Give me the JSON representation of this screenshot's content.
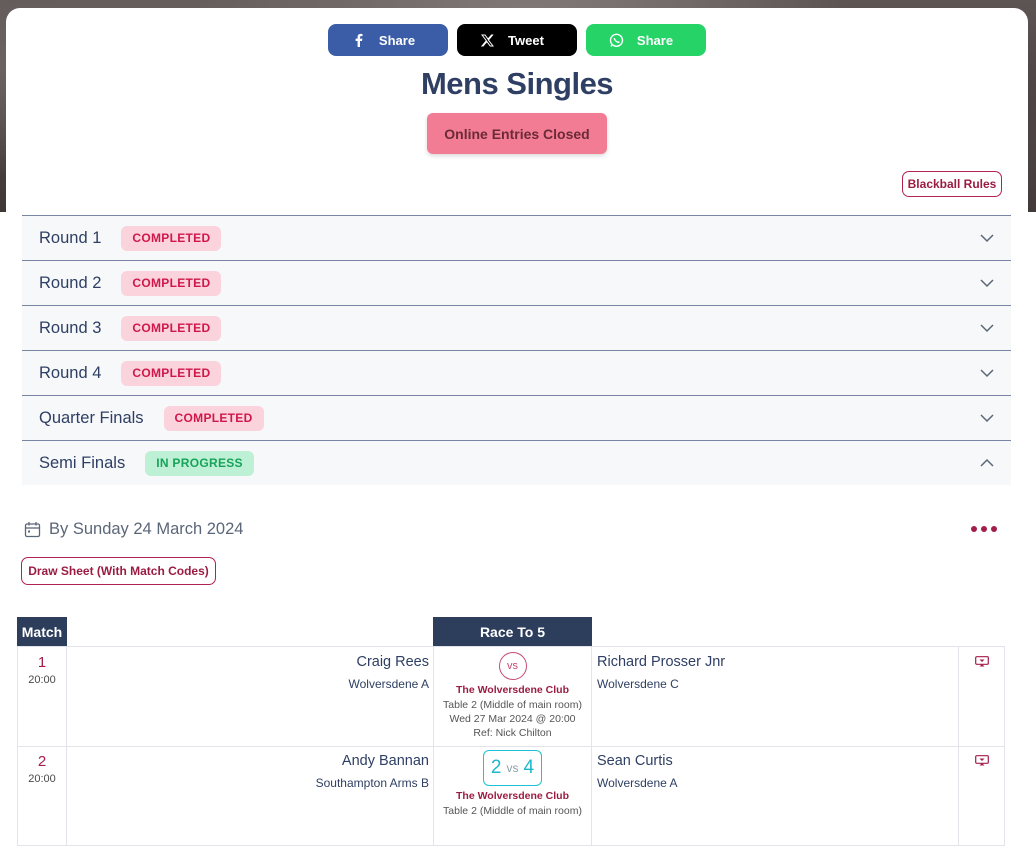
{
  "share": {
    "facebook_label": "Share",
    "twitter_label": "Tweet",
    "whatsapp_label": "Share"
  },
  "title": "Mens Singles",
  "entries_status": "Online Entries Closed",
  "rules_button": "Blackball Rules",
  "rounds": [
    {
      "name": "Round 1",
      "status": "COMPLETED",
      "expanded": false
    },
    {
      "name": "Round 2",
      "status": "COMPLETED",
      "expanded": false
    },
    {
      "name": "Round 3",
      "status": "COMPLETED",
      "expanded": false
    },
    {
      "name": "Round 4",
      "status": "COMPLETED",
      "expanded": false
    },
    {
      "name": "Quarter Finals",
      "status": "COMPLETED",
      "expanded": false
    },
    {
      "name": "Semi Finals",
      "status": "IN PROGRESS",
      "expanded": true
    }
  ],
  "semi": {
    "deadline": "By Sunday 24 March 2024",
    "draw_sheet_button": "Draw Sheet (With Match Codes)",
    "headers": {
      "match": "Match",
      "race": "Race To 5"
    },
    "matches": [
      {
        "num": "1",
        "time": "20:00",
        "home_player": "Craig Rees",
        "home_team": "Wolversdene A",
        "away_player": "Richard Prosser Jnr",
        "away_team": "Wolversdene C",
        "vs": "vs",
        "venue": "The Wolversdene Club",
        "table": "Table 2 (Middle of main room)",
        "when": "Wed 27 Mar 2024 @ 20:00",
        "ref": "Ref: Nick Chilton"
      },
      {
        "num": "2",
        "time": "20:00",
        "home_player": "Andy Bannan",
        "home_team": "Southampton Arms B",
        "away_player": "Sean Curtis",
        "away_team": "Wolversdene A",
        "score_home": "2",
        "vs": "vs",
        "score_away": "4",
        "venue": "The Wolversdene Club",
        "table": "Table 2 (Middle of main room)"
      }
    ]
  },
  "colors": {
    "facebook": "#3b5da8",
    "twitter": "#000000",
    "whatsapp": "#25d366",
    "title": "#2e3f63",
    "accent": "#a31d4b",
    "completed_badge": "#fbd3dc",
    "progress_badge": "#bdf0d4",
    "score": "#1fc2d4"
  },
  "icons": {
    "facebook": "facebook-icon",
    "twitter": "x-icon",
    "whatsapp": "whatsapp-icon",
    "calendar": "calendar-icon",
    "more": "more-dots-icon",
    "chevron_down": "chevron-down-icon",
    "chevron_up": "chevron-up-icon",
    "tv": "tv-icon"
  }
}
